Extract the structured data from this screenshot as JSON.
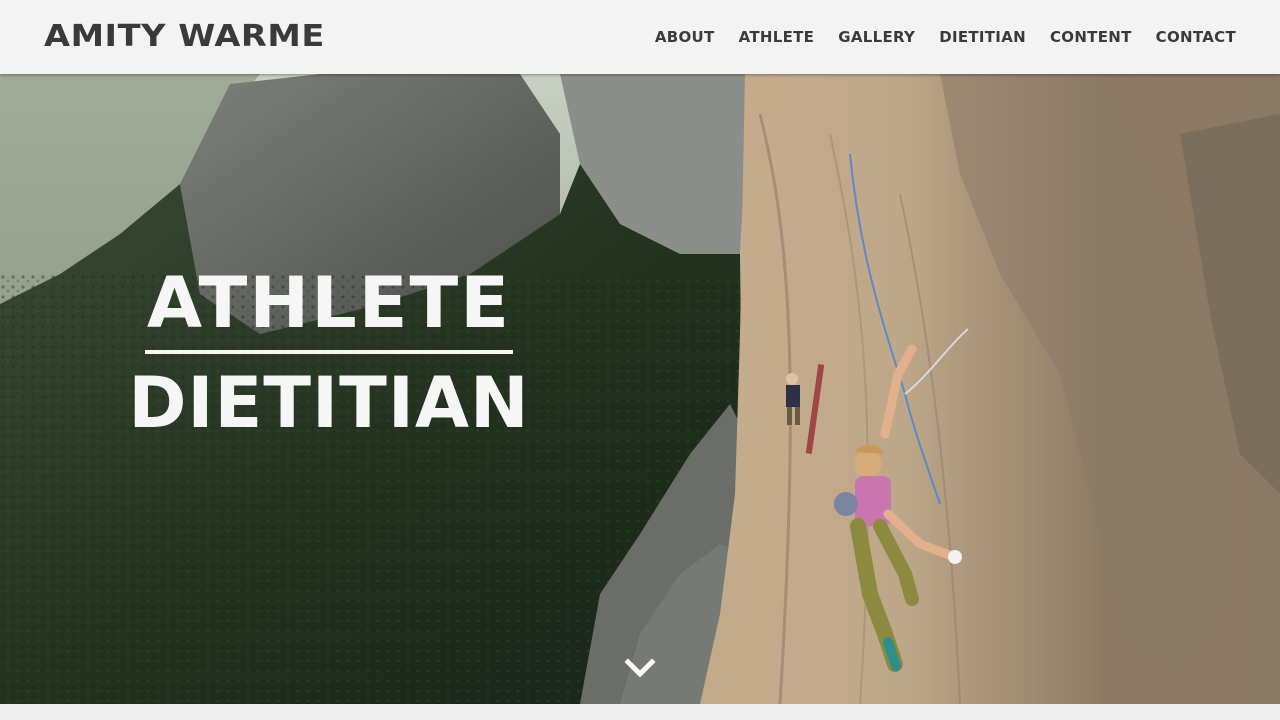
{
  "header": {
    "brand": "AMITY WARME",
    "nav": [
      "ABOUT",
      "ATHLETE",
      "GALLERY",
      "DIETITIAN",
      "CONTENT",
      "CONTACT"
    ]
  },
  "hero": {
    "line1": "ATHLETE",
    "line2": "DIETITIAN",
    "scroll_icon": "chevron-down-icon"
  },
  "colors": {
    "header_bg": "#f3f3f3",
    "brand_text": "#3a3a3a",
    "hero_text": "#f6f6f6"
  }
}
